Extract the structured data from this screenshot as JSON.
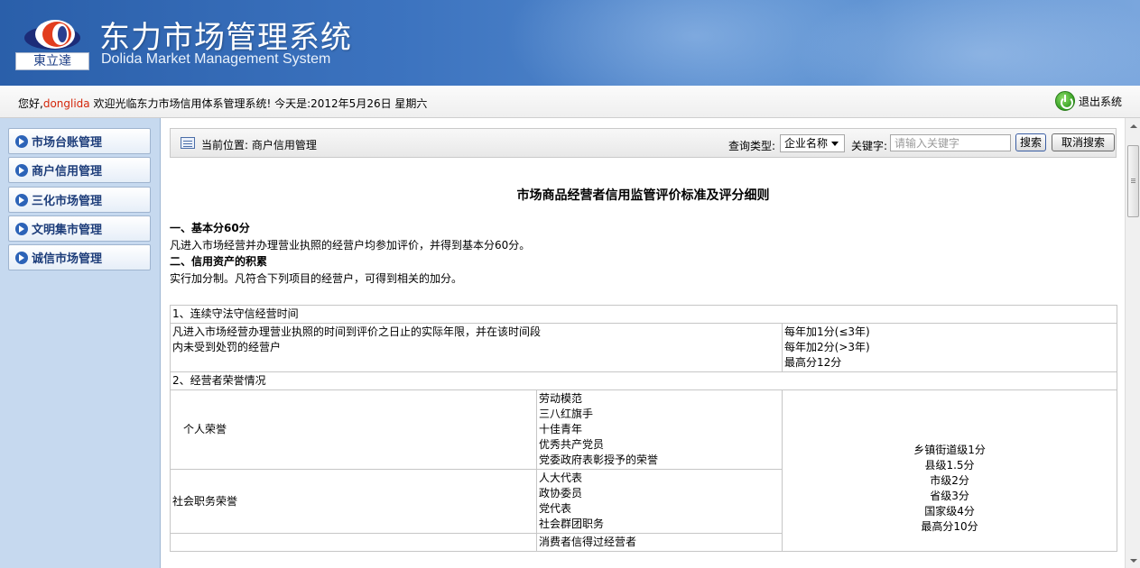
{
  "header": {
    "title": "东力市场管理系统",
    "subtitle": "Dolida Market Management System",
    "logo_text": "東立達"
  },
  "welcome": {
    "greeting": "您好,",
    "username": "donglida",
    "message": " 欢迎光临东力市场信用体系管理系统! 今天是:2012年5月26日 星期六",
    "logout_label": "退出系统"
  },
  "sidebar": {
    "items": [
      {
        "label": "市场台账管理"
      },
      {
        "label": "商户信用管理"
      },
      {
        "label": "三化市场管理"
      },
      {
        "label": "文明集市管理"
      },
      {
        "label": "诚信市场管理"
      }
    ]
  },
  "toolbar": {
    "location": "当前位置: 商户信用管理",
    "query_type_label": "查询类型:",
    "query_type_value": "企业名称",
    "keyword_label": "关键字:",
    "keyword_placeholder": "请输入关键字",
    "search_label": "搜索",
    "cancel_label": "取消搜索"
  },
  "document": {
    "title": "市场商品经营者信用监管评价标准及评分细则",
    "section1_heading": "一、基本分60分",
    "section1_text": "凡进入市场经营并办理营业执照的经营户均参加评价，并得到基本分60分。",
    "section2_heading": "二、信用资产的积累",
    "section2_text": "实行加分制。凡符合下列项目的经营户，可得到相关的加分。"
  },
  "table": {
    "row1_title": "1、连续守法守信经营时间",
    "row1_desc": [
      "凡进入市场经营办理营业执照的时间到评价之日止的实际年限，并在该时间段",
      "内未受到处罚的经营户"
    ],
    "row1_scores": [
      "每年加1分(≤3年)",
      "每年加2分(>3年)",
      "最高分12分"
    ],
    "row2_title": "2、经营者荣誉情况",
    "personal_label": "个人荣誉",
    "personal_items": [
      "劳动模范",
      "三八红旗手",
      "十佳青年",
      "优秀共产党员",
      "党委政府表彰授予的荣誉"
    ],
    "social_label": "社会职务荣誉",
    "social_items": [
      "人大代表",
      "政协委员",
      "党代表",
      "社会群团职务"
    ],
    "consumer_items": [
      "消费者信得过经营者"
    ],
    "honor_scores": [
      "乡镇街道级1分",
      "县级1.5分",
      "市级2分",
      "省级3分",
      "国家级4分",
      "最高分10分"
    ]
  },
  "colors": {
    "banner": "#3c73bf",
    "sidebar_bg": "#c6d9ef",
    "nav_text": "#1d3d7a",
    "username": "#d4260a"
  }
}
